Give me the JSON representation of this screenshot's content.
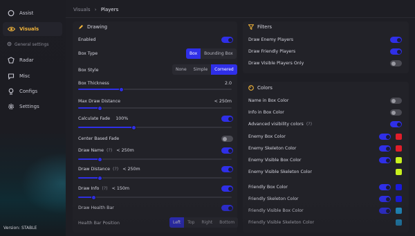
{
  "sidebar": {
    "items": [
      {
        "label": "Assist",
        "icon": "circle-icon"
      },
      {
        "label": "Visuals",
        "icon": "eye-icon"
      },
      {
        "label": "Radar",
        "icon": "radar-icon"
      },
      {
        "label": "Misc",
        "icon": "chat-icon"
      },
      {
        "label": "Configs",
        "icon": "bulb-icon"
      },
      {
        "label": "Settings",
        "icon": "gear-icon"
      }
    ],
    "sub_item": "General settings",
    "version": "Version:  STABLE"
  },
  "breadcrumb": {
    "parent": "Visuals",
    "separator": "›",
    "current": "Players"
  },
  "drawing": {
    "title": "Drawing",
    "enabled": {
      "label": "Enabled",
      "on": true
    },
    "box_type": {
      "label": "Box Type",
      "options": [
        "Box",
        "Bounding Box"
      ],
      "selected": "Box"
    },
    "box_style": {
      "label": "Box Style",
      "options": [
        "None",
        "Simple",
        "Cornered"
      ],
      "selected": "Cornered"
    },
    "box_thickness": {
      "label": "Box Thickness",
      "value": "2.0",
      "level": 0.28
    },
    "max_draw_distance": {
      "label": "Max Draw Distance",
      "value": "< 250m",
      "level": 0.14
    },
    "calculate_fade": {
      "label": "Calculate Fade",
      "value": "100%",
      "on": true,
      "level": 0.36
    },
    "center_based_fade": {
      "label": "Center Based Fade",
      "on": false
    },
    "draw_name": {
      "label": "Draw Name",
      "hint": "(?)",
      "value": "< 250m",
      "on": true,
      "level": 0.14
    },
    "draw_distance": {
      "label": "Draw Distance",
      "hint": "(?)",
      "value": "< 250m",
      "on": true,
      "level": 0.14
    },
    "draw_info": {
      "label": "Draw Info",
      "hint": "(?)",
      "value": "< 150m",
      "on": true,
      "level": 0.1
    },
    "draw_health_bar": {
      "label": "Draw Health Bar",
      "on": true
    },
    "health_bar_position": {
      "label": "Health Bar Position",
      "options": [
        "Left",
        "Top",
        "Right",
        "Bottom"
      ],
      "selected": "Left"
    }
  },
  "filters": {
    "title": "Filters",
    "items": [
      {
        "label": "Draw Enemy Players",
        "on": true
      },
      {
        "label": "Draw Friendly Players",
        "on": true
      },
      {
        "label": "Draw Visible Players Only",
        "on": false
      }
    ]
  },
  "colors": {
    "title": "Colors",
    "items": [
      {
        "label": "Name in Box Color",
        "on": false
      },
      {
        "label": "Info in Box Color",
        "on": false
      },
      {
        "label": "Advanced visibility colors",
        "hint": "(?)",
        "on": true
      },
      {
        "label": "Enemy Box Color",
        "on": true,
        "swatch": "#e11d2a"
      },
      {
        "label": "Enemy Skeleton Color",
        "on": true,
        "swatch": "#e11d2a"
      },
      {
        "label": "Enemy Visible Box Color",
        "on": true,
        "swatch": "#c8f01e"
      },
      {
        "label": "Enemy Visible Skeleton Color",
        "swatch": "#c8f01e"
      },
      {
        "label": "Friendly Box Color",
        "on": true,
        "swatch": "#1a1adc"
      },
      {
        "label": "Friendly Skeleton Color",
        "on": true,
        "swatch": "#1a1adc"
      },
      {
        "label": "Friendly Visible Box Color",
        "on": true,
        "swatch": "#1e9ad6"
      },
      {
        "label": "Friendly Visible Skeleton Color",
        "swatch": "#1e9ad6"
      }
    ]
  },
  "accent": "#2f2fe8",
  "active_accent": "#f0b33a"
}
